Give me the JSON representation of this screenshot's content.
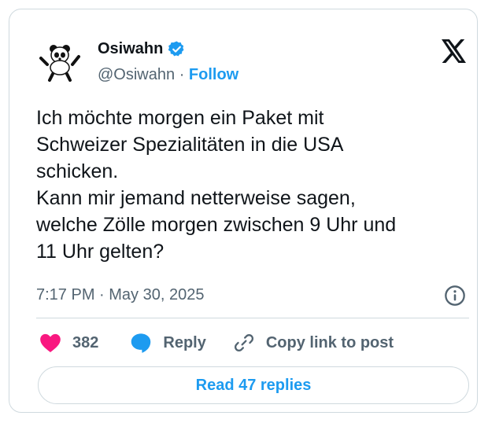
{
  "author": {
    "name": "Osiwahn",
    "handle": "@Osiwahn",
    "separator": "·",
    "follow_label": "Follow"
  },
  "tweet": {
    "text": "Ich möchte morgen ein Paket mit\nSchweizer Spezialitäten in die USA\nschicken.\nKann mir jemand netterweise sagen,\nwelche Zölle morgen zwischen 9 Uhr und\n11 Uhr gelten?",
    "timestamp": "7:17 PM · May 30, 2025"
  },
  "actions": {
    "likes": "382",
    "reply_label": "Reply",
    "copy_label": "Copy link to post"
  },
  "read_replies_label": "Read 47 replies",
  "icons": {
    "avatar": "panda-avatar",
    "verified": "verified-badge-icon",
    "logo": "x-logo-icon",
    "info": "info-icon",
    "like": "heart-icon",
    "reply": "speech-bubble-icon",
    "copy": "link-icon"
  },
  "colors": {
    "accent": "#1d9bf0",
    "like": "#f91880",
    "text": "#0f1419",
    "muted": "#536471",
    "border": "#cfd9de"
  }
}
